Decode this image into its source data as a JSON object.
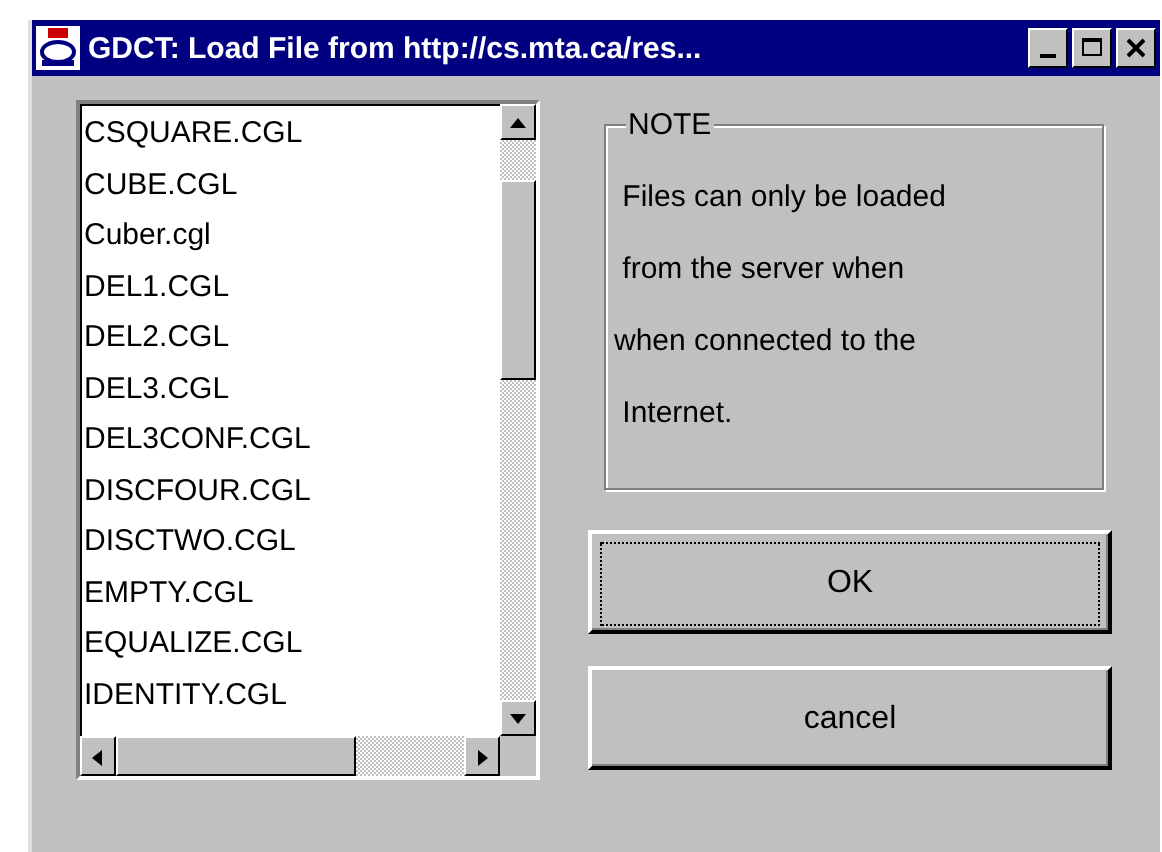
{
  "window": {
    "title": "GDCT: Load File from http://cs.mta.ca/res..."
  },
  "file_list": {
    "items": [
      {
        "label": "CSQUARE.CGL",
        "selected": false
      },
      {
        "label": "CUBE.CGL",
        "selected": false
      },
      {
        "label": "Cuber.cgl",
        "selected": false
      },
      {
        "label": "DEL1.CGL",
        "selected": false
      },
      {
        "label": "DEL2.CGL",
        "selected": false
      },
      {
        "label": "DEL3.CGL",
        "selected": false
      },
      {
        "label": "DEL3CONF.CGL",
        "selected": false
      },
      {
        "label": "DISCFOUR.CGL",
        "selected": false
      },
      {
        "label": "DISCTWO.CGL",
        "selected": false
      },
      {
        "label": "EMPTY.CGL",
        "selected": false
      },
      {
        "label": "EQUALIZE.CGL",
        "selected": false
      },
      {
        "label": "IDENTITY.CGL",
        "selected": false
      }
    ]
  },
  "note": {
    "title": "NOTE",
    "lines": [
      " Files can only be loaded",
      " from the server when",
      "when connected to the",
      " Internet."
    ]
  },
  "buttons": [
    {
      "label": "OK",
      "focused": true
    },
    {
      "label": "cancel",
      "focused": false
    }
  ]
}
